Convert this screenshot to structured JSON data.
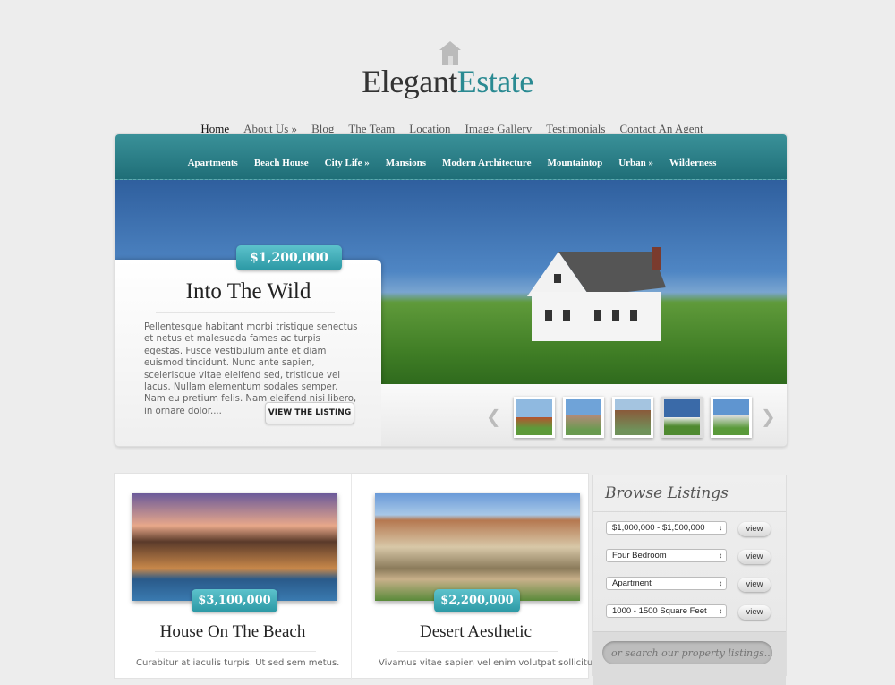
{
  "logo": {
    "part1": "Elegant",
    "part2": "Estate"
  },
  "main_nav": [
    "Home",
    "About Us »",
    "Blog",
    "The Team",
    "Location",
    "Image Gallery",
    "Testimonials",
    "Contact An Agent"
  ],
  "category_nav": [
    "Apartments",
    "Beach House",
    "City Life »",
    "Mansions",
    "Modern Architecture",
    "Mountaintop",
    "Urban »",
    "Wilderness"
  ],
  "featured": {
    "price": "$1,200,000",
    "title": "Into The Wild",
    "description": "Pellentesque habitant morbi tristique senectus et netus et malesuada fames ac turpis egestas. Fusce vestibulum ante et diam euismod tincidunt. Nunc ante sapien, scelerisque vitae eleifend sed, tristique vel lacus. Nullam elementum sodales semper. Nam eu pretium felis. Nam eleifend nisi libero, in ornare dolor....",
    "button": "VIEW THE LISTING",
    "active_thumb": 4,
    "thumb_count": 5
  },
  "listings": [
    {
      "price": "$3,100,000",
      "title": "House On The Beach",
      "excerpt": "Curabitur at iaculis turpis. Ut sed sem metus."
    },
    {
      "price": "$2,200,000",
      "title": "Desert Aesthetic",
      "excerpt": "Vivamus vitae sapien vel enim volutpat sollicitudin id"
    }
  ],
  "sidebar": {
    "title": "Browse Listings",
    "filters": [
      "$1,000,000 - $1,500,000",
      "Four Bedroom",
      "Apartment",
      "1000 - 1500 Square Feet"
    ],
    "view_label": "view",
    "search_placeholder": "or search our property listings..."
  },
  "colors": {
    "accent": "#2a8a92",
    "teal_bar": "#1f6e77"
  }
}
